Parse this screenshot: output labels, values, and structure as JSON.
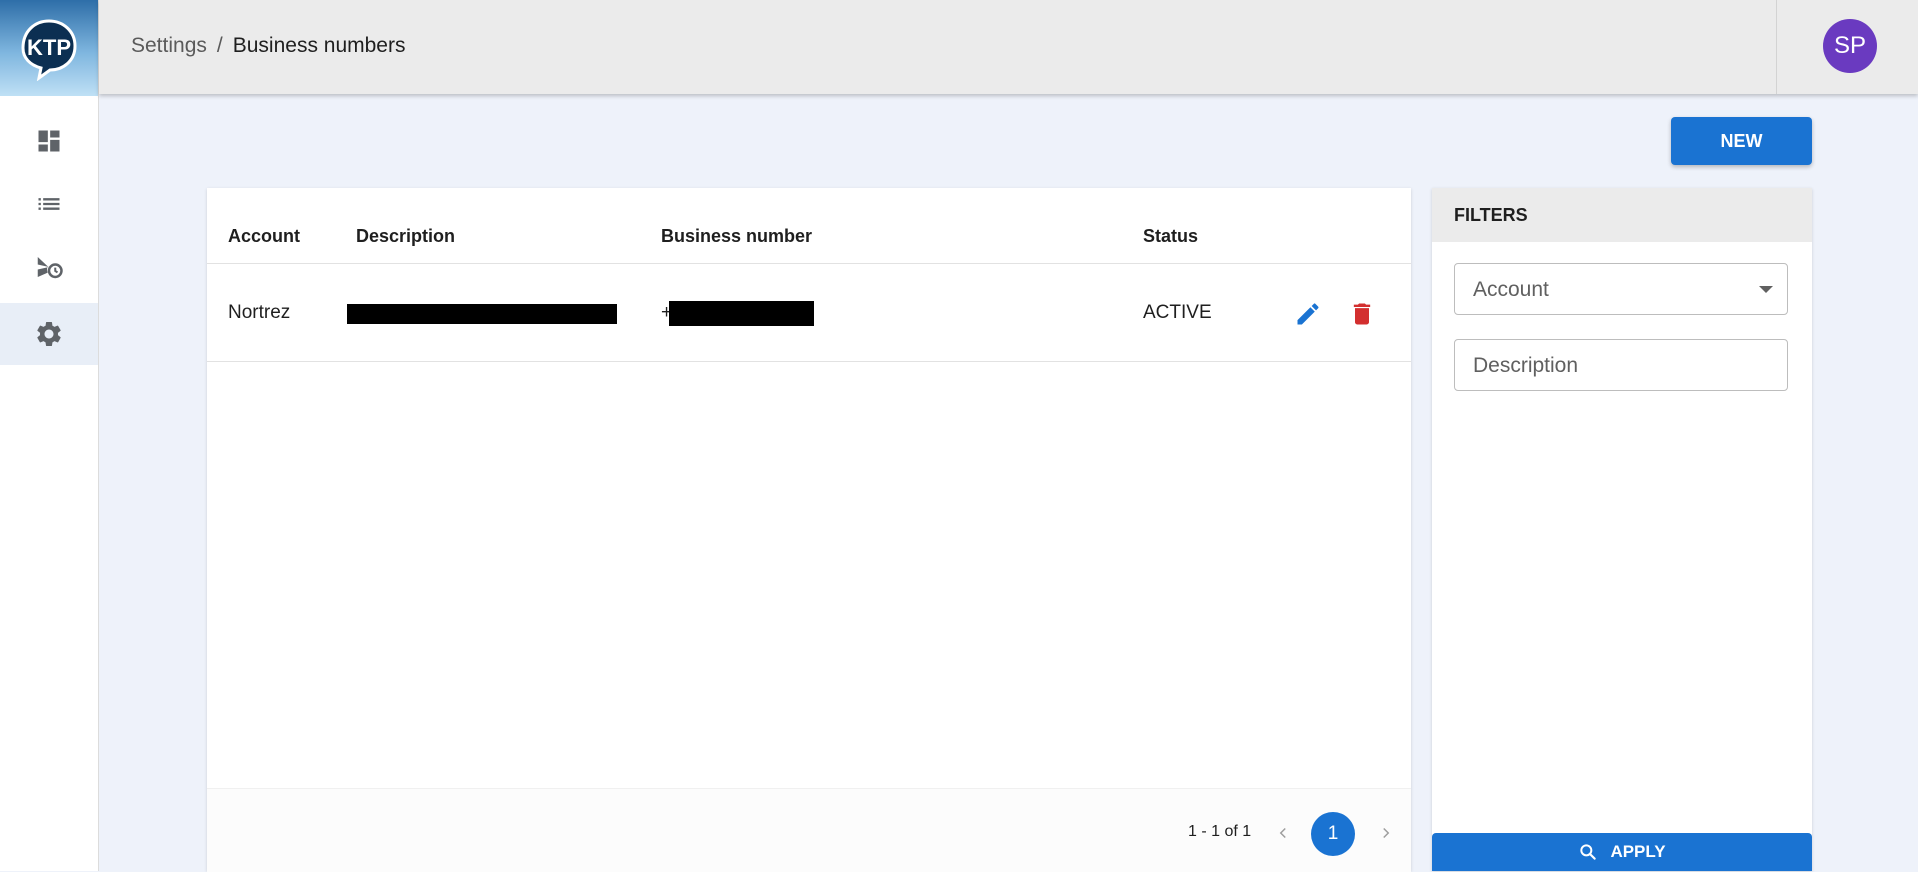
{
  "app": {
    "logo_text": "KTP"
  },
  "sidebar": {
    "items": [
      {
        "icon": "dashboard-icon",
        "label": "Dashboard"
      },
      {
        "icon": "list-icon",
        "label": "List"
      },
      {
        "icon": "history-icon",
        "label": "History"
      },
      {
        "icon": "settings-icon",
        "label": "Settings",
        "active": true
      }
    ]
  },
  "header": {
    "breadcrumb": {
      "parent": "Settings",
      "separator": "/",
      "current": "Business numbers"
    },
    "avatar_initials": "SP"
  },
  "toolbar": {
    "new_label": "NEW"
  },
  "table": {
    "columns": [
      "Account",
      "Description",
      "Business number",
      "Status"
    ],
    "rows": [
      {
        "account": "Nortrez",
        "description": "",
        "business_number_prefix": "+",
        "status": "ACTIVE"
      }
    ],
    "pagination": {
      "range": "1 - 1 of 1",
      "current_page": "1"
    }
  },
  "filters": {
    "title": "FILTERS",
    "account_placeholder": "Account",
    "description_placeholder": "Description",
    "apply_label": "APPLY"
  },
  "colors": {
    "accent": "#1a73d2",
    "delete": "#d32f2f",
    "avatar": "#6a3ac0",
    "header_bg": "#ebebeb",
    "page_bg": "#eef2fa"
  }
}
